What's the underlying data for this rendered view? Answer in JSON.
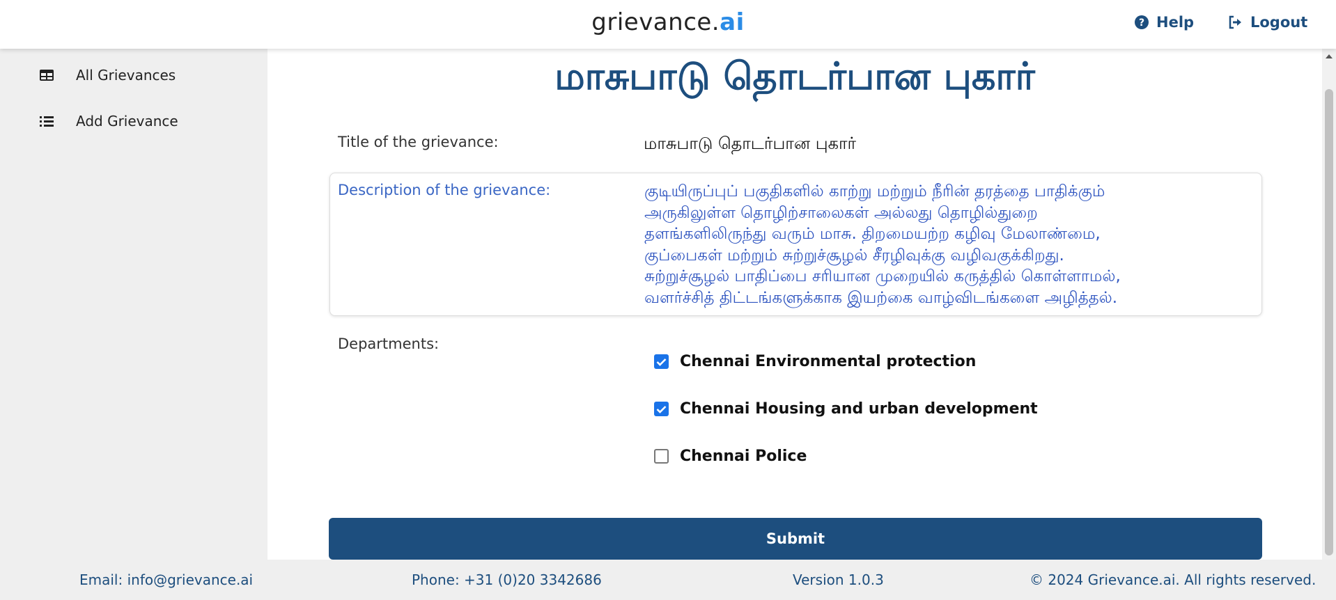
{
  "header": {
    "brand_main": "grievance.",
    "brand_ai": "ai",
    "help_label": "Help",
    "logout_label": "Logout",
    "help_icon": "question-circle-icon",
    "logout_icon": "sign-out-icon"
  },
  "sidebar": {
    "items": [
      {
        "label": "All Grievances",
        "icon": "table-icon"
      },
      {
        "label": "Add Grievance",
        "icon": "list-icon"
      }
    ]
  },
  "main": {
    "page_title": "மாசுபாடு தொடர்பான புகார்",
    "title_label": "Title of the grievance:",
    "title_value": "மாசுபாடு தொடர்பான புகார்",
    "description_label": "Description of the grievance:",
    "description_value": "குடியிருப்புப் பகுதிகளில் காற்று மற்றும் நீரின் தரத்தை பாதிக்கும்\nஅருகிலுள்ள தொழிற்சாலைகள் அல்லது தொழில்துறை\nதளங்களிலிருந்து வரும் மாசு. திறமையற்ற கழிவு மேலாண்மை,\nகுப்பைகள் மற்றும் சுற்றுச்சூழல் சீரழிவுக்கு வழிவகுக்கிறது.\nசுற்றுச்சூழல் பாதிப்பை சரியான முறையில் கருத்தில் கொள்ளாமல்,\nவளர்ச்சித் திட்டங்களுக்காக இயற்கை வாழ்விடங்களை அழித்தல்.",
    "departments_label": "Departments:",
    "departments": [
      {
        "label": "Chennai Environmental protection",
        "checked": true
      },
      {
        "label": "Chennai Housing and urban development",
        "checked": true
      },
      {
        "label": "Chennai Police",
        "checked": false
      }
    ],
    "submit_label": "Submit"
  },
  "footer": {
    "email": "Email: info@grievance.ai",
    "phone": "Phone: +31 (0)20 3342686",
    "version": "Version 1.0.3",
    "copyright": "© 2024 Grievance.ai. All rights reserved."
  },
  "colors": {
    "primary": "#1d4e7e",
    "accent": "#2b8ce6",
    "checkbox": "#1a73e8",
    "description_text": "#2f55c0"
  }
}
